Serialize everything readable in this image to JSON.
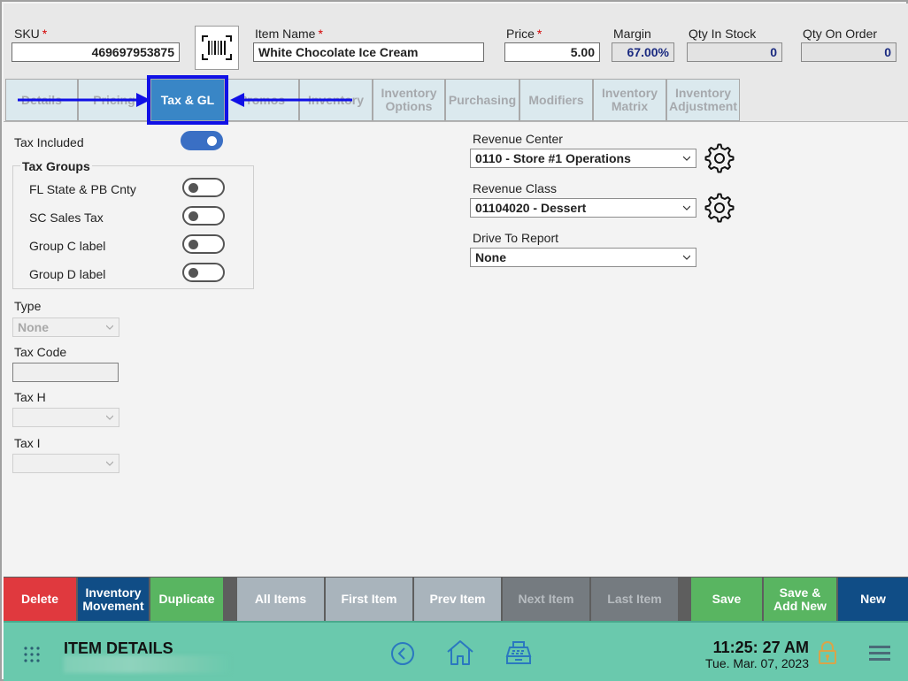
{
  "header": {
    "sku_label": "SKU",
    "sku_value": "469697953875",
    "item_name_label": "Item Name",
    "item_name_value": "White Chocolate Ice Cream",
    "price_label": "Price",
    "price_value": "5.00",
    "margin_label": "Margin",
    "margin_value": "67.00%",
    "qty_in_stock_label": "Qty In Stock",
    "qty_in_stock_value": "0",
    "qty_on_order_label": "Qty On Order",
    "qty_on_order_value": "0",
    "required_marker": "*"
  },
  "tabs": [
    {
      "label": "Details"
    },
    {
      "label": "Pricing"
    },
    {
      "label": "Tax & GL",
      "active": true
    },
    {
      "label": "Promos"
    },
    {
      "label": "Inventory"
    },
    {
      "label": "Inventory Options"
    },
    {
      "label": "Purchasing"
    },
    {
      "label": "Modifiers"
    },
    {
      "label": "Inventory Matrix"
    },
    {
      "label": "Inventory Adjustment"
    }
  ],
  "tax": {
    "tax_included_label": "Tax Included",
    "tax_included_on": true,
    "tax_groups_title": "Tax Groups",
    "groups": [
      {
        "label": "FL State & PB Cnty",
        "on": false
      },
      {
        "label": "SC Sales Tax",
        "on": false
      },
      {
        "label": "Group C label",
        "on": false
      },
      {
        "label": "Group D label",
        "on": false
      }
    ],
    "type_label": "Type",
    "type_value": "None",
    "tax_code_label": "Tax Code",
    "tax_h_label": "Tax H",
    "tax_i_label": "Tax I"
  },
  "gl": {
    "revenue_center_label": "Revenue Center",
    "revenue_center_value": "0110 - Store #1 Operations",
    "revenue_class_label": "Revenue Class",
    "revenue_class_value": "01104020 - Dessert",
    "drive_to_report_label": "Drive To Report",
    "drive_to_report_value": "None"
  },
  "actions": {
    "delete": "Delete",
    "inventory_movement": "Inventory Movement",
    "duplicate": "Duplicate",
    "all_items": "All Items",
    "first_item": "First Item",
    "prev_item": "Prev Item",
    "next_item": "Next Item",
    "last_item": "Last Item",
    "save": "Save",
    "save_add_new": "Save & Add New",
    "new": "New"
  },
  "footer": {
    "title": "ITEM DETAILS",
    "time": "11:25: 27 AM",
    "date": "Tue. Mar. 07, 2023"
  },
  "colors": {
    "accent_tab": "#3986c6",
    "highlight": "#1010e6",
    "footer_bg": "#6ac9ad",
    "delete": "#e0393e",
    "navy": "#104d86",
    "green": "#59b561"
  },
  "icons": [
    "barcode-icon",
    "gear-icon",
    "apps-grid-icon",
    "back-circle-icon",
    "home-icon",
    "register-icon",
    "lock-icon",
    "hamburger-menu-icon"
  ]
}
